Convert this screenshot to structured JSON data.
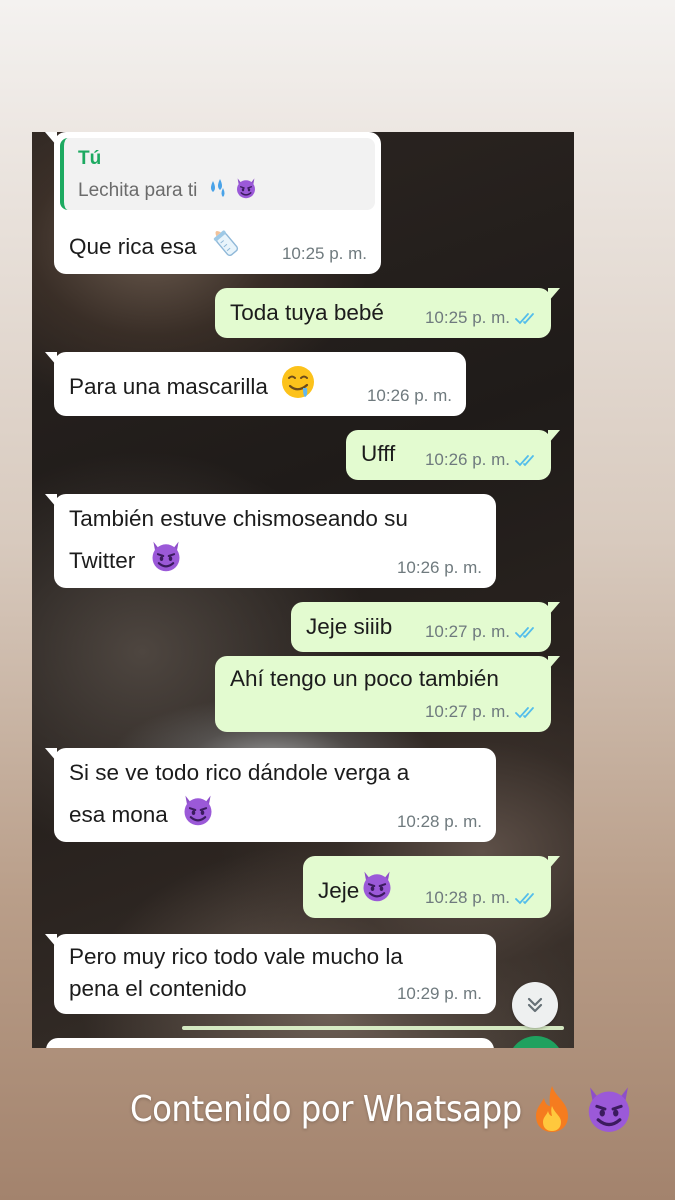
{
  "messages": [
    {
      "id": "m1",
      "dir": "in",
      "quote": {
        "author": "Tú",
        "text": "Lechita para ti"
      },
      "text": "Que rica esa",
      "time": "10:25 p. m."
    },
    {
      "id": "m2",
      "dir": "out",
      "text": "Toda tuya bebé",
      "time": "10:25 p. m."
    },
    {
      "id": "m3",
      "dir": "in",
      "text": "Para una mascarilla",
      "time": "10:26 p. m."
    },
    {
      "id": "m4",
      "dir": "out",
      "text": "Ufff",
      "time": "10:26 p. m."
    },
    {
      "id": "m5",
      "dir": "in",
      "lines": [
        "También estuve chismoseando su",
        "Twitter"
      ],
      "time": "10:26 p. m."
    },
    {
      "id": "m6",
      "dir": "out",
      "text": "Jeje siiib",
      "time": "10:27 p. m."
    },
    {
      "id": "m7",
      "dir": "out",
      "text": "Ahí tengo un poco también",
      "time": "10:27 p. m."
    },
    {
      "id": "m8",
      "dir": "in",
      "lines": [
        "Si se ve todo rico dándole verga a",
        "esa mona"
      ],
      "time": "10:28 p. m."
    },
    {
      "id": "m9",
      "dir": "out",
      "text": "Jeje",
      "time": "10:28 p. m."
    },
    {
      "id": "m10",
      "dir": "in",
      "lines": [
        "Pero muy rico todo vale mucho la",
        "pena el contenido"
      ],
      "time": "10:29 p. m."
    }
  ],
  "icons": {
    "read_receipt": "double-check-icon",
    "scroll": "chevron-double-down-icon",
    "emojis": [
      "sweat-droplets-emoji",
      "smiling-devil-emoji",
      "baby-bottle-emoji",
      "drooling-face-emoji",
      "fire-emoji"
    ]
  },
  "caption": {
    "text": "Contenido por Whatsapp"
  },
  "colors": {
    "incoming": "#ffffff",
    "outgoing": "#e3fbd0",
    "accent": "#1daa61",
    "ticks": "#53bdeb"
  }
}
